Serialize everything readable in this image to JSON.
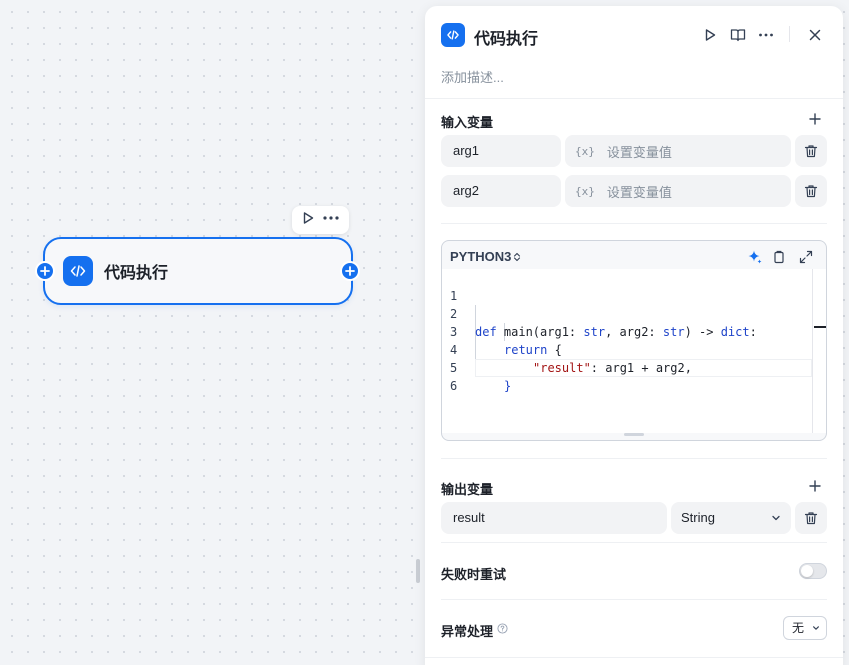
{
  "canvas": {
    "node": {
      "title": "代码执行"
    }
  },
  "panel": {
    "title": "代码执行",
    "description_placeholder": "添加描述...",
    "input_section": {
      "title": "输入变量",
      "variables": [
        {
          "name": "arg1",
          "value_tag": "{x}",
          "value_placeholder": "设置变量值"
        },
        {
          "name": "arg2",
          "value_tag": "{x}",
          "value_placeholder": "设置变量值"
        }
      ]
    },
    "code": {
      "language": "PYTHON3",
      "lines": [
        {
          "n": "1"
        },
        {
          "n": "2"
        },
        {
          "n": "3"
        },
        {
          "n": "4"
        },
        {
          "n": "5"
        },
        {
          "n": "6"
        }
      ],
      "tokens": {
        "def": "def",
        "sig": " main(arg1: ",
        "str1": "str",
        "sig2": ", arg2: ",
        "str2": "str",
        "sig3": ") -> ",
        "dict": "dict",
        "sig4": ":",
        "ret": "return",
        "brace_open": " {",
        "key": "\"result\"",
        "expr": ": arg1 + arg2,",
        "brace_close": "}"
      }
    },
    "output_section": {
      "title": "输出变量",
      "variables": [
        {
          "name": "result",
          "type": "String"
        }
      ]
    },
    "retry": {
      "label": "失败时重试",
      "enabled": false
    },
    "error_handling": {
      "label": "异常处理",
      "value": "无"
    }
  },
  "colors": {
    "accent": "#1570ef",
    "keyword": "#1f44c9",
    "string": "#a31515"
  }
}
